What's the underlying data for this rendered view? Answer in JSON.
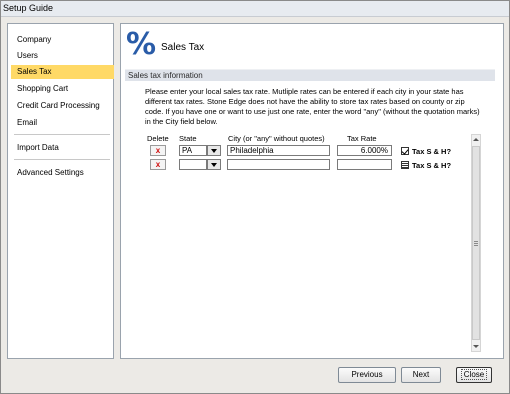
{
  "window": {
    "title": "Setup Guide"
  },
  "sidebar": {
    "items": [
      {
        "label": "Company"
      },
      {
        "label": "Users"
      },
      {
        "label": "Sales Tax",
        "active": true
      },
      {
        "label": "Shopping Cart"
      },
      {
        "label": "Credit Card Processing"
      },
      {
        "label": "Email"
      },
      {
        "label": "Import Data"
      },
      {
        "label": "Advanced Settings"
      }
    ]
  },
  "page": {
    "icon": "percent-icon",
    "icon_glyph": "%",
    "title": "Sales Tax",
    "section_title": "Sales tax information",
    "description": "Please enter your local sales tax rate.  Mutliple rates can be entered if each city in your state has different tax rates.  Stone Edge does not have the ability to store tax rates based on county or zip code.  If you have one or want to use just one rate, enter the word \"any\" (without the quotation marks) in the City field below."
  },
  "table": {
    "headers": {
      "delete": "Delete",
      "state": "State",
      "city": "City (or \"any\" without quotes)",
      "rate": "Tax Rate"
    },
    "delete_glyph": "x",
    "tax_sh_label": "Tax S & H?",
    "rows": [
      {
        "state": "PA",
        "city": "Philadelphia",
        "rate": "6.000%",
        "tax_sh": "checked"
      },
      {
        "state": "",
        "city": "",
        "rate": "",
        "tax_sh": "indeterminate"
      }
    ]
  },
  "buttons": {
    "previous": "Previous",
    "next": "Next",
    "close": "Close"
  },
  "colors": {
    "active_nav": "#ffd966",
    "section_bar": "#dfe3ea",
    "delete_x": "#d01010",
    "icon": "#2a5ca8"
  }
}
